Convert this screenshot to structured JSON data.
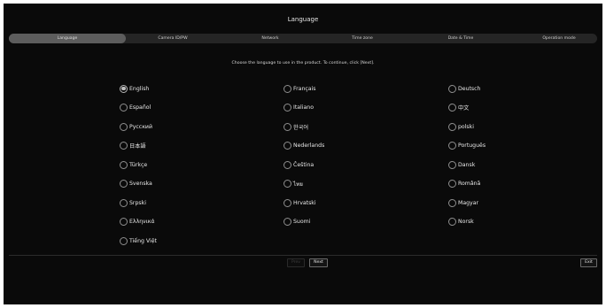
{
  "window": {
    "title": "Language"
  },
  "tabs": [
    {
      "label": "Language",
      "active": true
    },
    {
      "label": "Camera ID/PW",
      "active": false
    },
    {
      "label": "Network",
      "active": false
    },
    {
      "label": "Time zone",
      "active": false
    },
    {
      "label": "Date & Time",
      "active": false
    },
    {
      "label": "Operation mode",
      "active": false
    }
  ],
  "instruction": "Choose the language to use in the product. To continue, click [Next].",
  "languages": [
    {
      "label": "English",
      "selected": true
    },
    {
      "label": "Français",
      "selected": false
    },
    {
      "label": "Deutsch",
      "selected": false
    },
    {
      "label": "Español",
      "selected": false
    },
    {
      "label": "Italiano",
      "selected": false
    },
    {
      "label": "中文",
      "selected": false
    },
    {
      "label": "Русский",
      "selected": false
    },
    {
      "label": "한국어",
      "selected": false
    },
    {
      "label": "polski",
      "selected": false
    },
    {
      "label": "日本語",
      "selected": false
    },
    {
      "label": "Nederlands",
      "selected": false
    },
    {
      "label": "Português",
      "selected": false
    },
    {
      "label": "Türkçe",
      "selected": false
    },
    {
      "label": "Čeština",
      "selected": false
    },
    {
      "label": "Dansk",
      "selected": false
    },
    {
      "label": "Svenska",
      "selected": false
    },
    {
      "label": "ไทย",
      "selected": false
    },
    {
      "label": "Română",
      "selected": false
    },
    {
      "label": "Srpski",
      "selected": false
    },
    {
      "label": "Hrvatski",
      "selected": false
    },
    {
      "label": "Magyar",
      "selected": false
    },
    {
      "label": "Ελληνικά",
      "selected": false
    },
    {
      "label": "Suomi",
      "selected": false
    },
    {
      "label": "Norsk",
      "selected": false
    },
    {
      "label": "Tiếng Việt",
      "selected": false
    }
  ],
  "buttons": {
    "prev_label": "Prev",
    "prev_enabled": false,
    "next_label": "Next",
    "exit_label": "Exit"
  },
  "colors": {
    "background": "#0a0a0a",
    "tab_bar": "#252525",
    "tab_active": "#5d5d5d",
    "text": "#e8e8e8"
  },
  "icons": {
    "radio_selected": "radio-selected-icon",
    "radio_unselected": "radio-unselected-icon"
  }
}
